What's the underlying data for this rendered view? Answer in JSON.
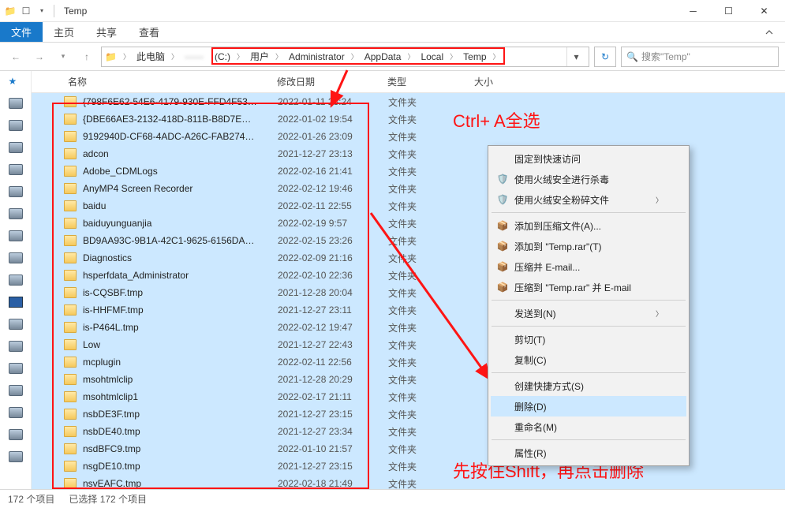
{
  "window": {
    "title": "Temp"
  },
  "ribbon": {
    "file": "文件",
    "tabs": [
      "主页",
      "共享",
      "查看"
    ]
  },
  "breadcrumb": {
    "root": "此电脑",
    "parts": [
      "(C:)",
      "用户",
      "Administrator",
      "AppData",
      "Local",
      "Temp"
    ]
  },
  "search": {
    "placeholder": "搜索\"Temp\""
  },
  "columns": {
    "name": "名称",
    "date": "修改日期",
    "type": "类型",
    "size": "大小"
  },
  "file_type_label": "文件夹",
  "files": [
    {
      "name": "{798F6E62-54E6-4179-930E-FFD4F53…",
      "date": "2022-01-11 23:24"
    },
    {
      "name": "{DBE66AE3-2132-418D-811B-B8D7E…",
      "date": "2022-01-02 19:54"
    },
    {
      "name": "9192940D-CF68-4ADC-A26C-FAB274…",
      "date": "2022-01-26 23:09"
    },
    {
      "name": "adcon",
      "date": "2021-12-27 23:13"
    },
    {
      "name": "Adobe_CDMLogs",
      "date": "2022-02-16 21:41"
    },
    {
      "name": "AnyMP4 Screen Recorder",
      "date": "2022-02-12 19:46"
    },
    {
      "name": "baidu",
      "date": "2022-02-11 22:55"
    },
    {
      "name": "baiduyunguanjia",
      "date": "2022-02-19 9:57"
    },
    {
      "name": "BD9AA93C-9B1A-42C1-9625-6156DA…",
      "date": "2022-02-15 23:26"
    },
    {
      "name": "Diagnostics",
      "date": "2022-02-09 21:16"
    },
    {
      "name": "hsperfdata_Administrator",
      "date": "2022-02-10 22:36"
    },
    {
      "name": "is-CQSBF.tmp",
      "date": "2021-12-28 20:04"
    },
    {
      "name": "is-HHFMF.tmp",
      "date": "2021-12-27 23:11"
    },
    {
      "name": "is-P464L.tmp",
      "date": "2022-02-12 19:47"
    },
    {
      "name": "Low",
      "date": "2021-12-27 22:43"
    },
    {
      "name": "mcplugin",
      "date": "2022-02-11 22:56"
    },
    {
      "name": "msohtmlclip",
      "date": "2021-12-28 20:29"
    },
    {
      "name": "msohtmlclip1",
      "date": "2022-02-17 21:11"
    },
    {
      "name": "nsbDE3F.tmp",
      "date": "2021-12-27 23:15"
    },
    {
      "name": "nsbDE40.tmp",
      "date": "2021-12-27 23:34"
    },
    {
      "name": "nsdBFC9.tmp",
      "date": "2022-01-10 21:57"
    },
    {
      "name": "nsgDE10.tmp",
      "date": "2021-12-27 23:15"
    },
    {
      "name": "nsvEAFC.tmp",
      "date": "2022-02-18 21:49"
    }
  ],
  "statusbar": {
    "items": "172 个项目",
    "selected": "已选择 172 个项目"
  },
  "context_menu": {
    "pin": "固定到快速访问",
    "huorong_scan": "使用火绒安全进行杀毒",
    "huorong_shred": "使用火绒安全粉碎文件",
    "add_archive": "添加到压缩文件(A)...",
    "add_temp_rar": "添加到 \"Temp.rar\"(T)",
    "compress_email": "压缩并 E-mail...",
    "compress_temp_email": "压缩到 \"Temp.rar\" 并 E-mail",
    "send_to": "发送到(N)",
    "cut": "剪切(T)",
    "copy": "复制(C)",
    "shortcut": "创建快捷方式(S)",
    "delete": "删除(D)",
    "rename": "重命名(M)",
    "properties": "属性(R)"
  },
  "annotations": {
    "select_all": "Ctrl+ A全选",
    "shift_delete": "先按住Shift，再点击删除"
  }
}
